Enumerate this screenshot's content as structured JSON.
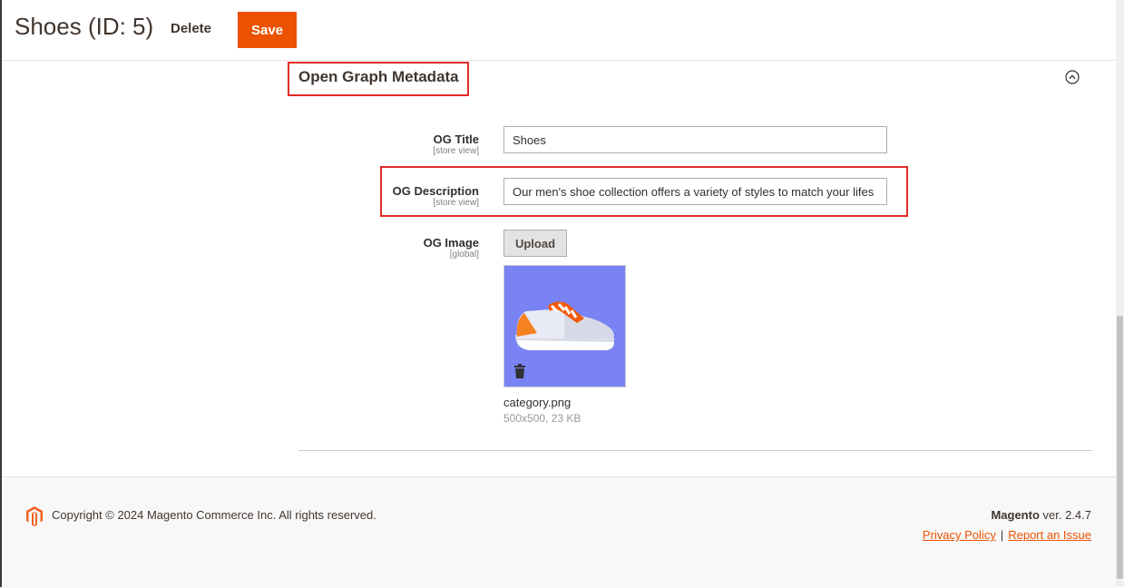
{
  "header": {
    "title": "Shoes (ID: 5)",
    "delete_label": "Delete",
    "save_label": "Save"
  },
  "section": {
    "title": "Open Graph Metadata",
    "collapse_icon": "chevron-up-circle-icon"
  },
  "fields": {
    "og_title": {
      "label": "OG Title",
      "scope": "[store view]",
      "value": "Shoes"
    },
    "og_description": {
      "label": "OG Description",
      "scope": "[store view]",
      "value": "Our men's shoe collection offers a variety of styles to match your lifes"
    },
    "og_image": {
      "label": "OG Image",
      "scope": "[global]",
      "upload_label": "Upload",
      "file_name": "category.png",
      "file_meta": "500x500, 23 KB"
    }
  },
  "footer": {
    "copyright": "Copyright © 2024 Magento Commerce Inc. All rights reserved.",
    "brand": "Magento",
    "version": " ver. 2.4.7",
    "privacy_link": "Privacy Policy",
    "separator": "|",
    "report_link": "Report an Issue"
  },
  "colors": {
    "accent": "#eb5202",
    "highlight": "#e02b27",
    "image_bg": "#7983f3"
  }
}
